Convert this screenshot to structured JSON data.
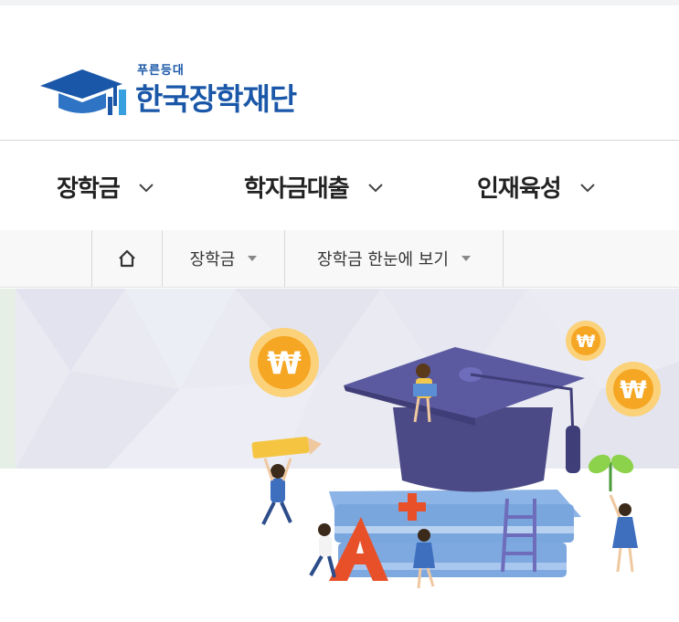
{
  "logo": {
    "small_text": "푸른등대",
    "main_text": "한국장학재단",
    "brand_color": "#1a57a8"
  },
  "gnb": {
    "items": [
      {
        "label": "장학금",
        "icon": "chevron-down-icon"
      },
      {
        "label": "학자금대출",
        "icon": "chevron-down-icon"
      },
      {
        "label": "인재육성",
        "icon": "chevron-down-icon"
      }
    ]
  },
  "breadcrumb": {
    "home_icon": "home-icon",
    "items": [
      {
        "label": "장학금"
      },
      {
        "label": "장학금 한눈에 보기"
      }
    ]
  },
  "hero": {
    "coin_symbol": "₩",
    "letters": [
      "A",
      "+"
    ],
    "colors": {
      "band": "#e9eaf2",
      "coin": "#f5a623",
      "cap": "#4b4a86",
      "book": "#7ea9e0"
    }
  }
}
